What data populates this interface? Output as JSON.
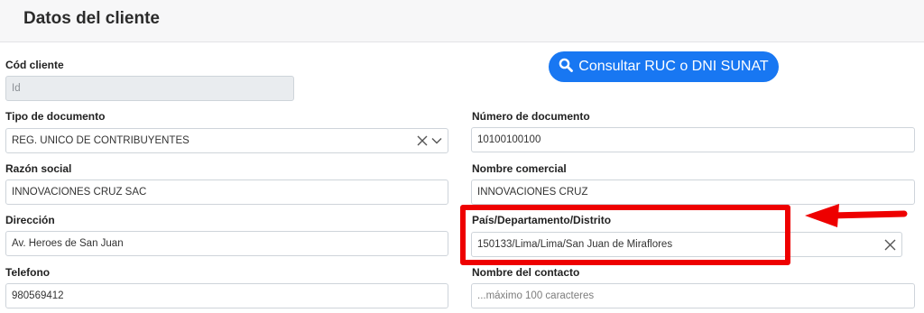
{
  "header": {
    "title": "Datos del cliente"
  },
  "sunat_button": {
    "label": "Consultar RUC o DNI SUNAT",
    "icon": "search-icon",
    "color": "#1877f2"
  },
  "form": {
    "cod_cliente": {
      "label": "Cód cliente",
      "value": "Id"
    },
    "tipo_documento": {
      "label": "Tipo de documento",
      "value": "REG. UNICO DE CONTRIBUYENTES"
    },
    "numero_documento": {
      "label": "Número de documento",
      "value": "10100100100"
    },
    "razon_social": {
      "label": "Razón social",
      "value": "INNOVACIONES CRUZ SAC"
    },
    "nombre_comercial": {
      "label": "Nombre comercial",
      "value": "INNOVACIONES CRUZ"
    },
    "direccion": {
      "label": "Dirección",
      "value": "Av. Heroes de San Juan"
    },
    "ubigeo": {
      "label": "País/Departamento/Distrito",
      "value": "150133/Lima/Lima/San Juan de Miraflores"
    },
    "telefono": {
      "label": "Telefono",
      "value": "980569412"
    },
    "nombre_contacto": {
      "label": "Nombre del contacto",
      "placeholder": "...máximo 100 caracteres"
    }
  },
  "annotation": {
    "highlight_color": "#ee0000"
  }
}
